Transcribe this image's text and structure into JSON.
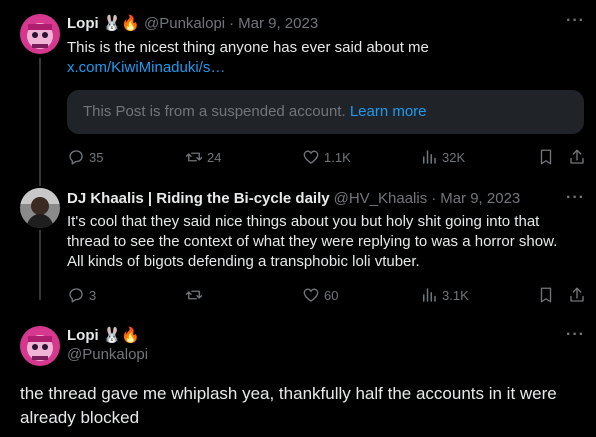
{
  "post1": {
    "author_name": "Lopi",
    "author_emojis": "🐰🔥",
    "handle": "@Punkalopi",
    "sep": "·",
    "date": "Mar 9, 2023",
    "text": "This is the nicest thing anyone has ever said about me",
    "link": "x.com/KiwiMinaduki/s…",
    "quote_notice": "This Post is from a suspended account.",
    "learn_more": "Learn more",
    "replies": "35",
    "reposts": "24",
    "likes": "1.1K",
    "views": "32K"
  },
  "post2": {
    "author_name": "DJ Khaalis | Riding the Bi-cycle daily",
    "handle": "@HV_Khaalis",
    "sep": "·",
    "date": "Mar 9, 2023",
    "text_lines": [
      "It's cool that they said nice things about you but holy shit going into that",
      "thread to see the context of what they were replying to was a horror show.",
      "All kinds of bigots defending a transphobic loli vtuber."
    ],
    "replies": "3",
    "reposts": "",
    "likes": "60",
    "views": "3.1K"
  },
  "post3": {
    "author_name": "Lopi",
    "author_emojis": "🐰🔥",
    "handle": "@Punkalopi",
    "text_lines": [
      "the thread gave me whiplash yea, thankfully half the accounts in it were",
      "already blocked"
    ]
  },
  "colors": {
    "background": "#000000",
    "text": "#e7e9ea",
    "muted": "#71767b",
    "link": "#1d9bf0",
    "card": "#202327"
  }
}
